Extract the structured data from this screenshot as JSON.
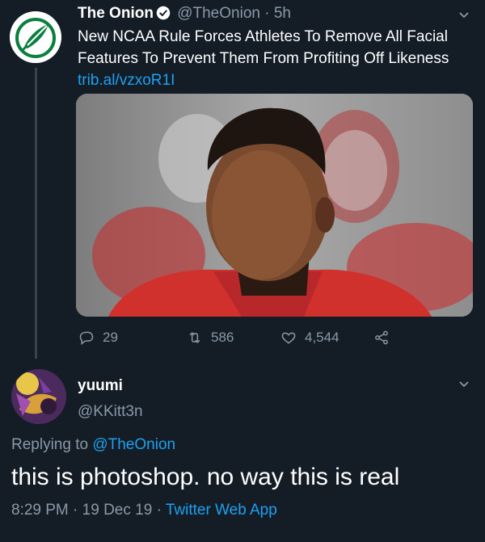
{
  "tweet": {
    "author_name": "The Onion",
    "author_handle": "@TheOnion",
    "separator": "·",
    "time_ago": "5h",
    "text": "New NCAA Rule Forces Athletes To Remove All Facial Features To Prevent Them From Profiting Off Likeness",
    "link": "trib.al/vzxoR1I",
    "stats": {
      "replies": "29",
      "retweets": "586",
      "likes": "4,544"
    }
  },
  "reply": {
    "author_name": "yuumi",
    "author_handle": "@KKitt3n",
    "replying_prefix": "Replying to",
    "replying_to": "@TheOnion",
    "text": "this is photoshop. no way this is real",
    "time": "8:29 PM",
    "date": "19 Dec 19",
    "source": "Twitter Web App",
    "separator": "·"
  },
  "colors": {
    "background": "#141d26",
    "muted": "#8899a6",
    "link": "#1da1f2",
    "onion_green": "#0a7f3f"
  },
  "icons": [
    "onion-logo",
    "verified-icon",
    "chevron-down-icon",
    "reply-icon",
    "retweet-icon",
    "like-icon",
    "share-icon"
  ]
}
